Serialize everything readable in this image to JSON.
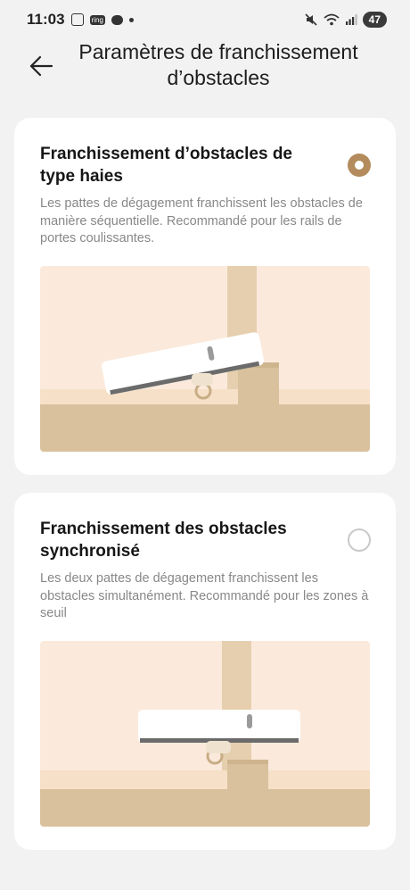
{
  "status_bar": {
    "time": "11:03",
    "ring_label": "ring",
    "battery": "47"
  },
  "header": {
    "title_line1": "Paramètres de franchissement",
    "title_line2": "d’obstacles"
  },
  "options": [
    {
      "title": "Franchissement d’obstacles de type haies",
      "description": "Les pattes de dégagement franchissent les obstacles de manière séquentielle. Recommandé pour les rails de portes coulissantes.",
      "selected": true
    },
    {
      "title": "Franchissement des obstacles synchronisé",
      "description": "Les deux pattes de dégagement franchissent les obstacles simultanément. Recommandé pour les zones à seuil",
      "selected": false
    }
  ],
  "colors": {
    "accent": "#b38b5d",
    "background": "#f3f2f3",
    "illustration_bg": "#fbeadc",
    "floor": "#d8c19c"
  }
}
